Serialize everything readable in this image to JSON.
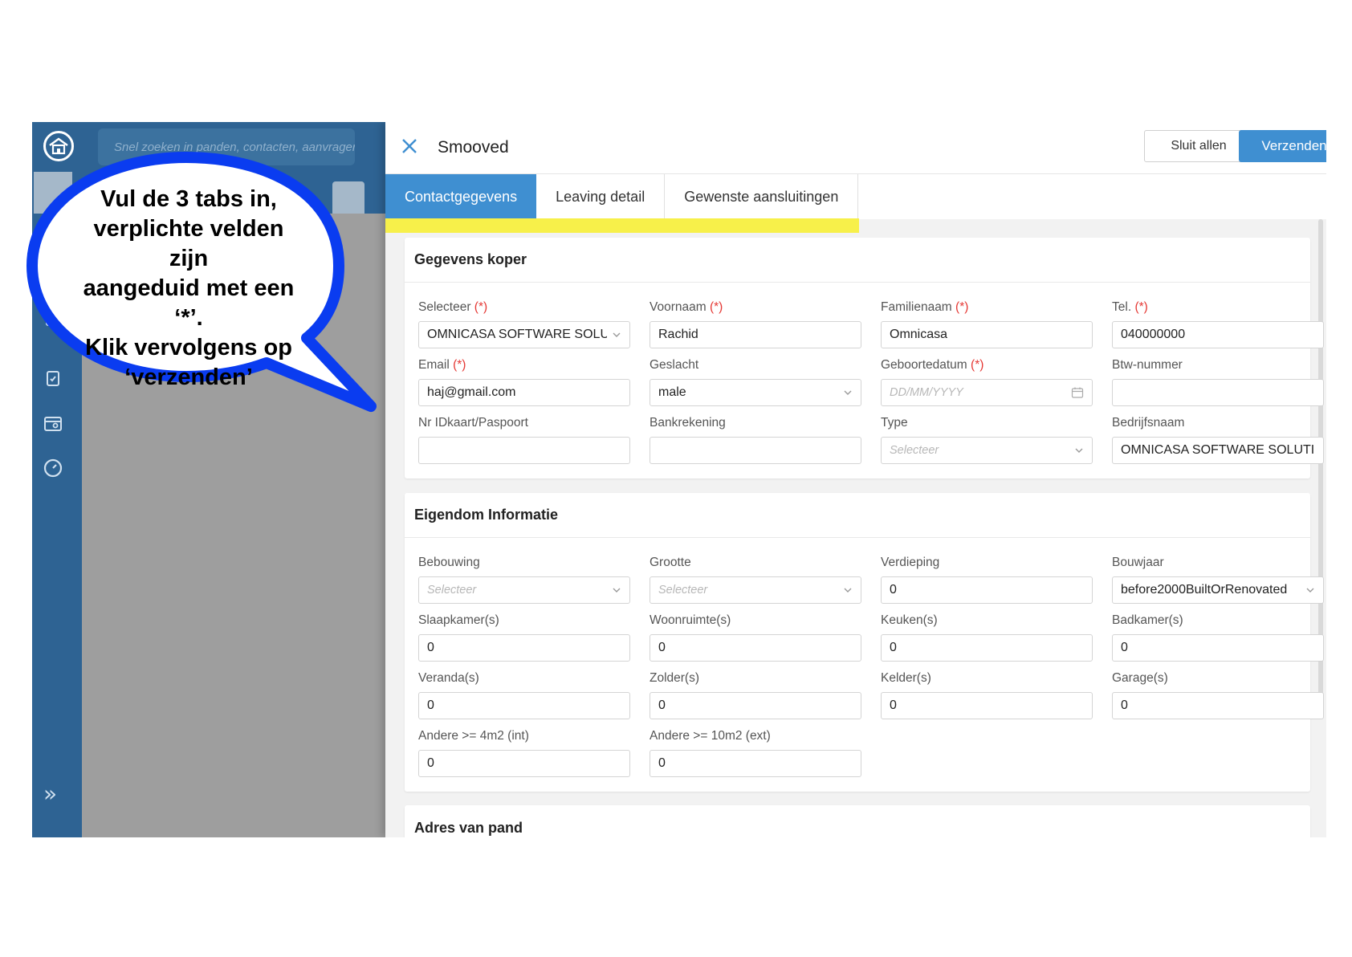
{
  "search": {
    "placeholder": "Snel zoeken in panden, contacten, aanvragen"
  },
  "panel": {
    "title": "Smooved",
    "close_label": "close",
    "sluit_label": "Sluit allen",
    "send_label": "Verzenden"
  },
  "tabs": [
    {
      "label": "Contactgegevens"
    },
    {
      "label": "Leaving detail"
    },
    {
      "label": "Gewenste aansluitingen"
    }
  ],
  "required_mark": "(*)",
  "sections": {
    "koper": {
      "title": "Gegevens koper",
      "fields": {
        "selecteer": {
          "label": "Selecteer",
          "value": "OMNICASA SOFTWARE SOLUT"
        },
        "voornaam": {
          "label": "Voornaam",
          "value": "Rachid"
        },
        "familienaam": {
          "label": "Familienaam",
          "value": "Omnicasa"
        },
        "tel": {
          "label": "Tel.",
          "value": "040000000"
        },
        "email": {
          "label": "Email",
          "value": "haj@gmail.com"
        },
        "geslacht": {
          "label": "Geslacht",
          "value": "male"
        },
        "geboortedatum": {
          "label": "Geboortedatum",
          "placeholder": "DD/MM/YYYY"
        },
        "btw": {
          "label": "Btw-nummer",
          "value": ""
        },
        "idkaart": {
          "label": "Nr IDkaart/Paspoort",
          "value": ""
        },
        "bank": {
          "label": "Bankrekening",
          "value": ""
        },
        "type": {
          "label": "Type",
          "placeholder": "Selecteer"
        },
        "bedrijf": {
          "label": "Bedrijfsnaam",
          "value": "OMNICASA SOFTWARE SOLUTIONS"
        }
      }
    },
    "eigendom": {
      "title": "Eigendom Informatie",
      "fields": {
        "bebouwing": {
          "label": "Bebouwing",
          "placeholder": "Selecteer"
        },
        "grootte": {
          "label": "Grootte",
          "placeholder": "Selecteer"
        },
        "verdieping": {
          "label": "Verdieping",
          "value": "0"
        },
        "bouwjaar": {
          "label": "Bouwjaar",
          "value": "before2000BuiltOrRenovated"
        },
        "slaapkamer": {
          "label": "Slaapkamer(s)",
          "value": "0"
        },
        "woonruimte": {
          "label": "Woonruimte(s)",
          "value": "0"
        },
        "keuken": {
          "label": "Keuken(s)",
          "value": "0"
        },
        "badkamer": {
          "label": "Badkamer(s)",
          "value": "0"
        },
        "veranda": {
          "label": "Veranda(s)",
          "value": "0"
        },
        "zolder": {
          "label": "Zolder(s)",
          "value": "0"
        },
        "kelder": {
          "label": "Kelder(s)",
          "value": "0"
        },
        "garage": {
          "label": "Garage(s)",
          "value": "0"
        },
        "andere_int": {
          "label": "Andere >= 4m2 (int)",
          "value": "0"
        },
        "andere_ext": {
          "label": "Andere >= 10m2 (ext)",
          "value": "0"
        }
      }
    },
    "adres": {
      "title": "Adres van pand"
    }
  },
  "callout": {
    "line1": "Vul de 3 tabs in,",
    "line2": "verplichte velden zijn",
    "line3": "aangeduid met een ‘*’.",
    "line4": "Klik vervolgens op",
    "line5": "‘verzenden’"
  },
  "colors": {
    "rail": "#2e6393",
    "accent": "#3f8fd1",
    "highlight": "#f7f04a",
    "bubble_border": "#0a3cf0",
    "required": "#e53935"
  },
  "icons": [
    "home-logo-icon",
    "search-icon",
    "calendar-icon",
    "clipboard-icon",
    "listing-icon",
    "gauge-icon",
    "double-chevron-right-icon",
    "close-icon",
    "chevron-down-icon"
  ]
}
